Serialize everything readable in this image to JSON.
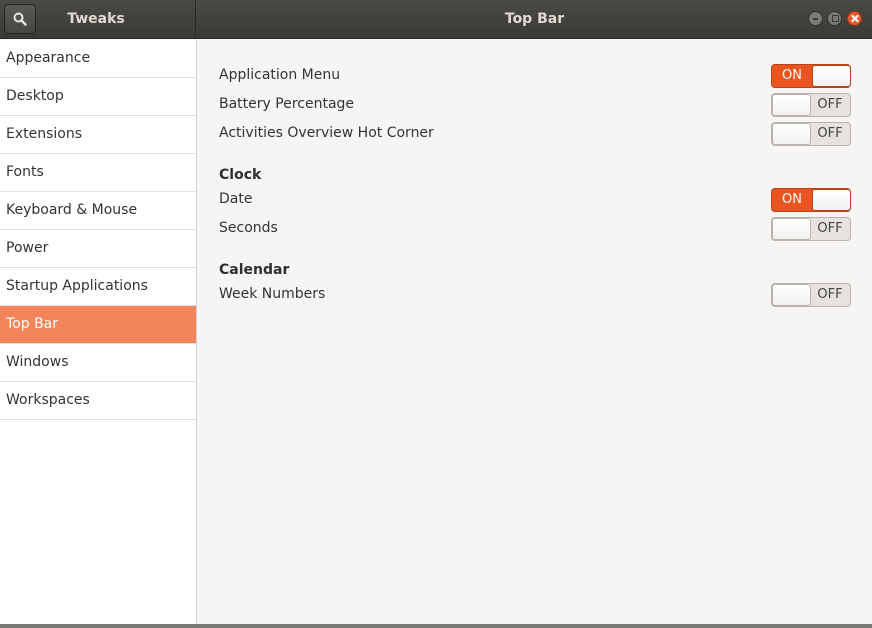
{
  "app": {
    "title": "Tweaks"
  },
  "window": {
    "title": "Top Bar"
  },
  "sidebar": {
    "items": [
      {
        "label": "Appearance"
      },
      {
        "label": "Desktop"
      },
      {
        "label": "Extensions"
      },
      {
        "label": "Fonts"
      },
      {
        "label": "Keyboard & Mouse"
      },
      {
        "label": "Power"
      },
      {
        "label": "Startup Applications"
      },
      {
        "label": "Top Bar",
        "selected": true
      },
      {
        "label": "Windows"
      },
      {
        "label": "Workspaces"
      }
    ]
  },
  "settings": {
    "application_menu": {
      "label": "Application Menu",
      "state": "ON"
    },
    "battery_percentage": {
      "label": "Battery Percentage",
      "state": "OFF"
    },
    "hot_corner": {
      "label": "Activities Overview Hot Corner",
      "state": "OFF"
    },
    "clock": {
      "heading": "Clock",
      "date": {
        "label": "Date",
        "state": "ON"
      },
      "seconds": {
        "label": "Seconds",
        "state": "OFF"
      }
    },
    "calendar": {
      "heading": "Calendar",
      "week_numbers": {
        "label": "Week Numbers",
        "state": "OFF"
      }
    }
  },
  "colors": {
    "accent": "#e95420",
    "selected_bg": "#f2855a",
    "titlebar": "#3d3c38"
  },
  "icons": [
    "search-icon",
    "minimize-icon",
    "maximize-icon",
    "close-icon"
  ]
}
